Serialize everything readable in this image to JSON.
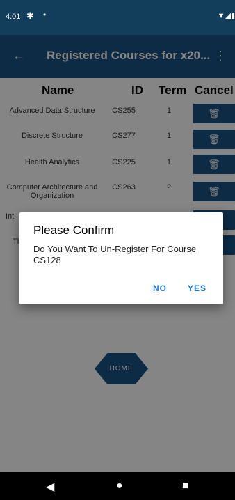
{
  "status": {
    "time": "4:01",
    "gear": "✱",
    "dot": "•",
    "right_icons": "▼◢▮"
  },
  "appbar": {
    "back_icon": "←",
    "title": "Registered Courses for x20...",
    "more_icon": "⋮"
  },
  "table": {
    "headers": [
      "Name",
      "ID",
      "Term",
      "Cancel"
    ],
    "rows": [
      {
        "name": "Advanced Data Structure",
        "id": "CS255",
        "term": "1"
      },
      {
        "name": "Discrete Structure",
        "id": "CS277",
        "term": "1"
      },
      {
        "name": "Health Analytics",
        "id": "CS225",
        "term": "1"
      },
      {
        "name": "Computer Architecture and Organization",
        "id": "CS263",
        "term": "2"
      },
      {
        "name": "Int",
        "id": "",
        "term": ""
      },
      {
        "name": "Th",
        "id": "",
        "term": ""
      }
    ],
    "trash_icon": "🗑"
  },
  "home": {
    "label": "HOME"
  },
  "dialog": {
    "title": "Please Confirm",
    "message": "Do You Want To Un-Register For Course CS128",
    "no_label": "NO",
    "yes_label": "YES"
  },
  "navbar": {
    "back": "◀",
    "home": "●",
    "recents": "■"
  },
  "colors": {
    "primary": "#195484",
    "statusbar": "#123e5c",
    "dialog_button": "#1a73c8"
  }
}
